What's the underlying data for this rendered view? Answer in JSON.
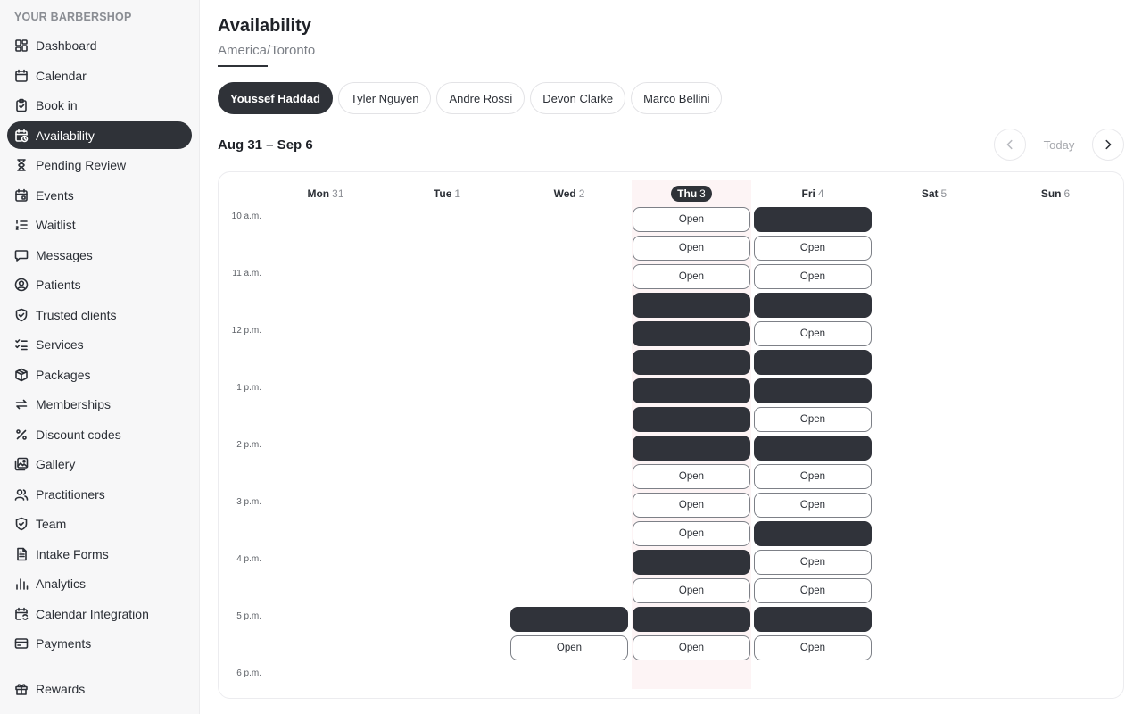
{
  "sidebar": {
    "brand": "YOUR BARBERSHOP",
    "items": [
      {
        "label": "Dashboard",
        "icon": "dashboard-icon",
        "active": false
      },
      {
        "label": "Calendar",
        "icon": "calendar-icon",
        "active": false
      },
      {
        "label": "Book in",
        "icon": "clipboard-icon",
        "active": false
      },
      {
        "label": "Availability",
        "icon": "calendar-clock-icon",
        "active": true
      },
      {
        "label": "Pending Review",
        "icon": "hourglass-icon",
        "active": false
      },
      {
        "label": "Events",
        "icon": "calendar-event-icon",
        "active": false
      },
      {
        "label": "Waitlist",
        "icon": "list-ordered-icon",
        "active": false
      },
      {
        "label": "Messages",
        "icon": "message-icon",
        "active": false
      },
      {
        "label": "Patients",
        "icon": "user-circle-icon",
        "active": false
      },
      {
        "label": "Trusted clients",
        "icon": "shield-check-icon",
        "active": false
      },
      {
        "label": "Services",
        "icon": "list-check-icon",
        "active": false
      },
      {
        "label": "Packages",
        "icon": "package-icon",
        "active": false
      },
      {
        "label": "Memberships",
        "icon": "repeat-icon",
        "active": false
      },
      {
        "label": "Discount codes",
        "icon": "percent-icon",
        "active": false
      },
      {
        "label": "Gallery",
        "icon": "gallery-icon",
        "active": false
      },
      {
        "label": "Practitioners",
        "icon": "users-icon",
        "active": false
      },
      {
        "label": "Team",
        "icon": "shield-icon",
        "active": false
      },
      {
        "label": "Intake Forms",
        "icon": "file-text-icon",
        "active": false
      },
      {
        "label": "Analytics",
        "icon": "bar-chart-icon",
        "active": false
      },
      {
        "label": "Calendar Integration",
        "icon": "calendar-sync-icon",
        "active": false
      },
      {
        "label": "Payments",
        "icon": "credit-card-icon",
        "active": false
      }
    ],
    "footer_items": [
      {
        "label": "Rewards",
        "icon": "gift-icon"
      }
    ]
  },
  "header": {
    "title": "Availability",
    "timezone": "America/Toronto"
  },
  "staff": [
    {
      "name": "Youssef Haddad",
      "active": true
    },
    {
      "name": "Tyler Nguyen",
      "active": false
    },
    {
      "name": "Andre Rossi",
      "active": false
    },
    {
      "name": "Devon Clarke",
      "active": false
    },
    {
      "name": "Marco Bellini",
      "active": false
    }
  ],
  "week": {
    "range": "Aug 31 – Sep 6",
    "today_label": "Today"
  },
  "calendar": {
    "days": [
      {
        "name": "Mon",
        "date": "31",
        "today": false
      },
      {
        "name": "Tue",
        "date": "1",
        "today": false
      },
      {
        "name": "Wed",
        "date": "2",
        "today": false
      },
      {
        "name": "Thu",
        "date": "3",
        "today": true
      },
      {
        "name": "Fri",
        "date": "4",
        "today": false
      },
      {
        "name": "Sat",
        "date": "5",
        "today": false
      },
      {
        "name": "Sun",
        "date": "6",
        "today": false
      }
    ],
    "time_labels": [
      "10 a.m.",
      "11 a.m.",
      "12 p.m.",
      "1 p.m.",
      "2 p.m.",
      "3 p.m.",
      "4 p.m.",
      "5 p.m.",
      "6 p.m."
    ],
    "open_label": "Open",
    "slots": [
      {
        "day": 3,
        "row": 0,
        "status": "open"
      },
      {
        "day": 3,
        "row": 1,
        "status": "open"
      },
      {
        "day": 3,
        "row": 2,
        "status": "open"
      },
      {
        "day": 3,
        "row": 3,
        "status": "booked"
      },
      {
        "day": 3,
        "row": 4,
        "status": "booked"
      },
      {
        "day": 3,
        "row": 5,
        "status": "booked"
      },
      {
        "day": 3,
        "row": 6,
        "status": "booked"
      },
      {
        "day": 3,
        "row": 7,
        "status": "booked"
      },
      {
        "day": 3,
        "row": 8,
        "status": "booked"
      },
      {
        "day": 3,
        "row": 9,
        "status": "open"
      },
      {
        "day": 3,
        "row": 10,
        "status": "open"
      },
      {
        "day": 3,
        "row": 11,
        "status": "open"
      },
      {
        "day": 3,
        "row": 12,
        "status": "booked"
      },
      {
        "day": 3,
        "row": 13,
        "status": "open"
      },
      {
        "day": 3,
        "row": 14,
        "status": "booked"
      },
      {
        "day": 3,
        "row": 15,
        "status": "open"
      },
      {
        "day": 4,
        "row": 0,
        "status": "booked"
      },
      {
        "day": 4,
        "row": 1,
        "status": "open"
      },
      {
        "day": 4,
        "row": 2,
        "status": "open"
      },
      {
        "day": 4,
        "row": 3,
        "status": "booked"
      },
      {
        "day": 4,
        "row": 4,
        "status": "open"
      },
      {
        "day": 4,
        "row": 5,
        "status": "booked"
      },
      {
        "day": 4,
        "row": 6,
        "status": "booked"
      },
      {
        "day": 4,
        "row": 7,
        "status": "open"
      },
      {
        "day": 4,
        "row": 8,
        "status": "booked"
      },
      {
        "day": 4,
        "row": 9,
        "status": "open"
      },
      {
        "day": 4,
        "row": 10,
        "status": "open"
      },
      {
        "day": 4,
        "row": 11,
        "status": "booked"
      },
      {
        "day": 4,
        "row": 12,
        "status": "open"
      },
      {
        "day": 4,
        "row": 13,
        "status": "open"
      },
      {
        "day": 4,
        "row": 14,
        "status": "booked"
      },
      {
        "day": 4,
        "row": 15,
        "status": "open"
      },
      {
        "day": 2,
        "row": 14,
        "status": "booked"
      },
      {
        "day": 2,
        "row": 15,
        "status": "open"
      }
    ]
  },
  "colors": {
    "dark": "#2f3238",
    "today_band": "#fdf4f5"
  }
}
